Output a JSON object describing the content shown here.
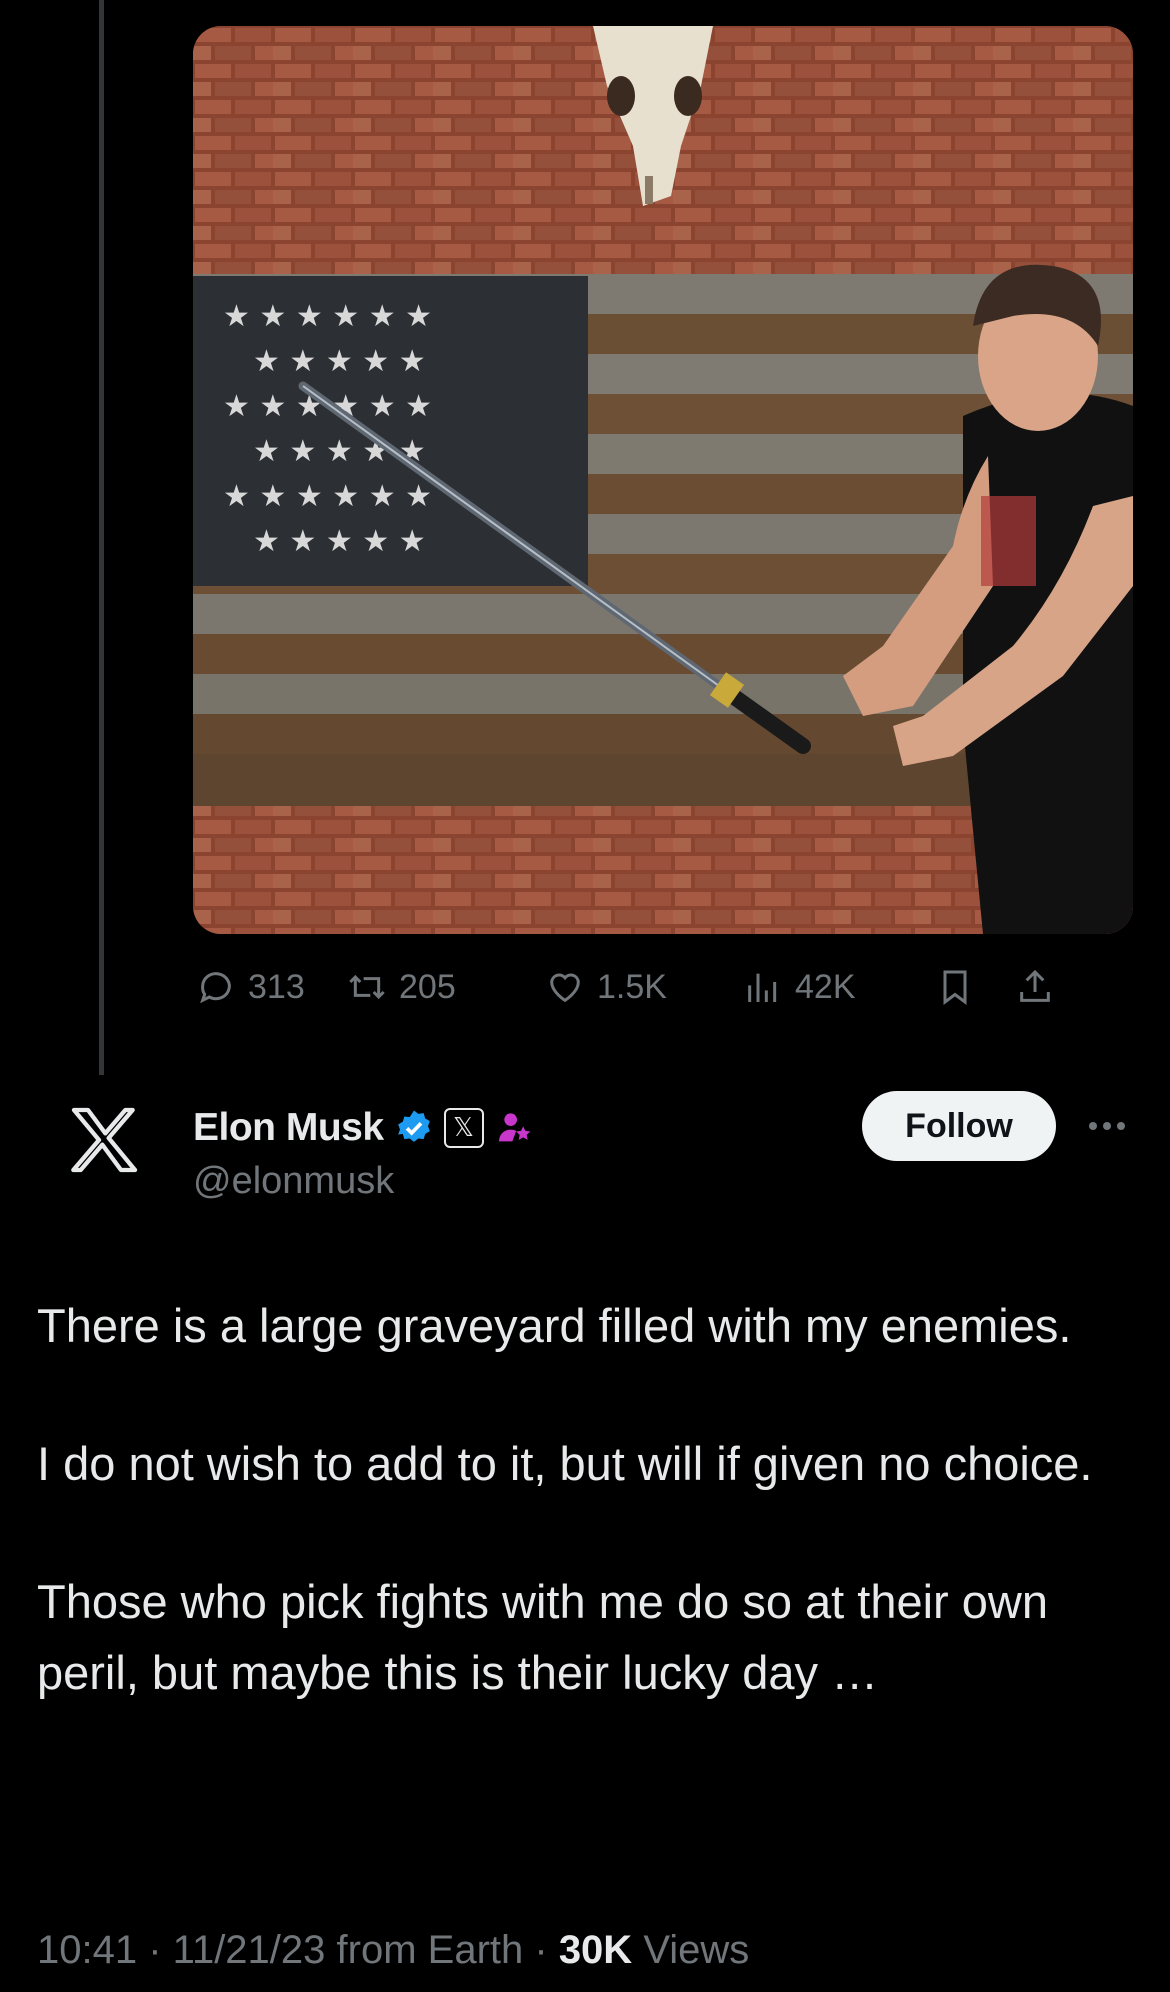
{
  "post_actions": {
    "replies": "313",
    "reposts": "205",
    "likes": "1.5K",
    "views": "42K"
  },
  "author": {
    "name": "Elon Musk",
    "handle": "@elonmusk",
    "affiliate_label": "𝕏",
    "follow_label": "Follow"
  },
  "tweet": {
    "paragraphs": [
      "There is a large graveyard filled with my enemies.",
      "I do not wish to add to it, but will if given no choice.",
      "Those who pick fights with me do so at their own peril, but maybe this is their lucky day …"
    ]
  },
  "meta": {
    "time": "10:41",
    "date": "11/21/23",
    "source": "from Earth",
    "views_count": "30K",
    "views_label": "Views"
  },
  "colors": {
    "background": "#000000",
    "text_primary": "#e7e9ea",
    "text_secondary": "#71767b",
    "verified_blue": "#1d9bf0",
    "affiliate_pink": "#c936cc"
  }
}
